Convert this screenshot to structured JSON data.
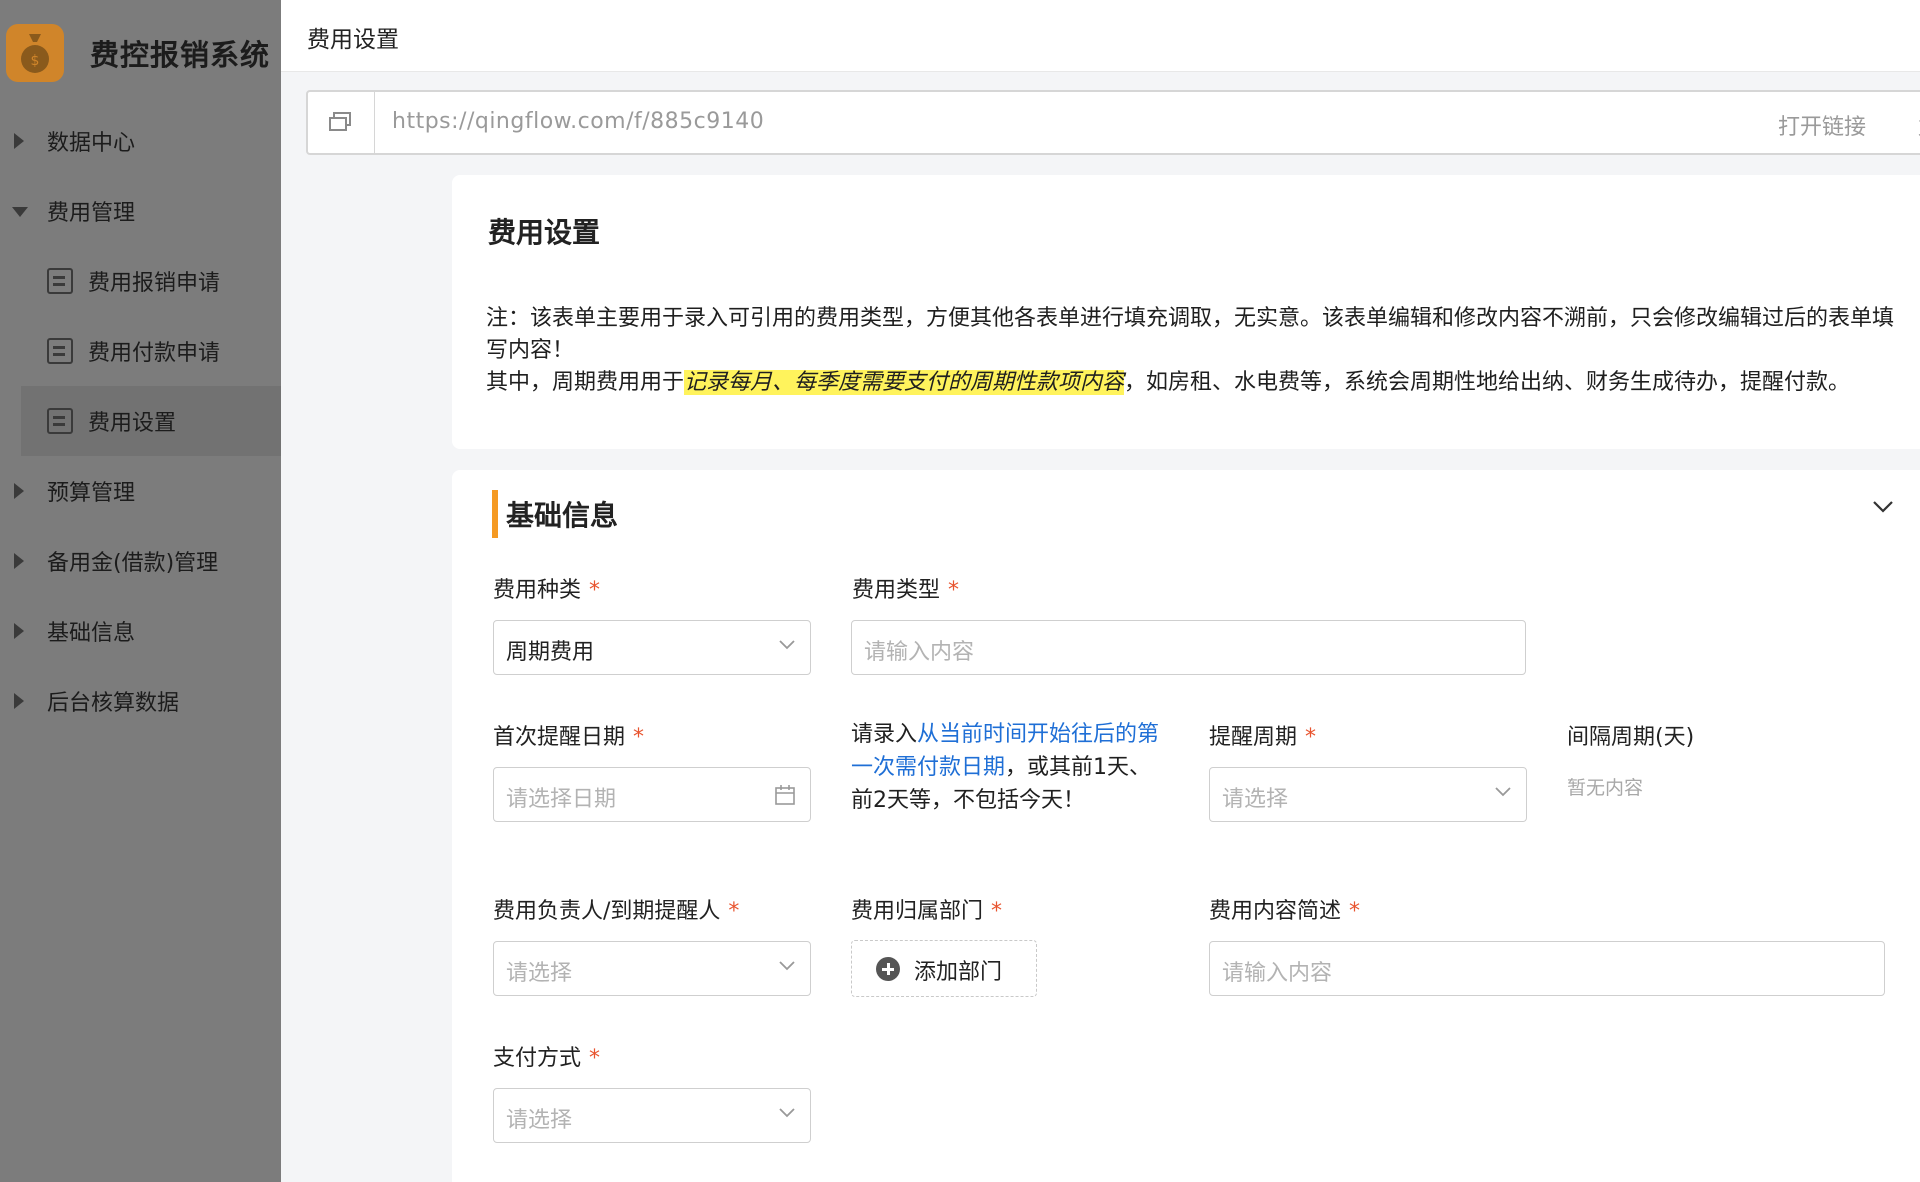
{
  "app": {
    "title": "费控报销系统"
  },
  "sidebar": {
    "items": [
      {
        "label": "数据中心",
        "expanded": false
      },
      {
        "label": "费用管理",
        "expanded": true
      },
      {
        "label": "费用报销申请",
        "sub": true
      },
      {
        "label": "费用付款申请",
        "sub": true
      },
      {
        "label": "费用设置",
        "sub": true,
        "active": true
      },
      {
        "label": "预算管理",
        "expanded": false
      },
      {
        "label": "备用金(借款)管理",
        "expanded": false
      },
      {
        "label": "基础信息",
        "expanded": false
      },
      {
        "label": "后台核算数据",
        "expanded": false
      }
    ]
  },
  "topbar": {
    "breadcrumb": "费用设置"
  },
  "urlbar": {
    "url": "https://qingflow.com/f/885c9140",
    "open_label": "打开链接",
    "more_label": "复"
  },
  "note_card": {
    "title": "费用设置",
    "line1": "注：该表单主要用于录入可引用的费用类型，方便其他各表单进行填充调取，无实意。该表单编辑和修改内容不溯前，只会修改编辑过后的表单填写内容！",
    "line2_prefix": "其中，周期费用用于",
    "line2_highlight": "记录每月、每季度需要支付的周期性款项内容",
    "line2_suffix": "，如房租、水电费等，系统会周期性地给出纳、财务生成待办，提醒付款。"
  },
  "form": {
    "section_title": "基础信息",
    "required_mark": "*",
    "fields": {
      "category": {
        "label": "费用种类",
        "value": "周期费用"
      },
      "type": {
        "label": "费用类型",
        "placeholder": "请输入内容"
      },
      "first_date": {
        "label": "首次提醒日期",
        "placeholder": "请选择日期"
      },
      "hint": {
        "prefix": "请录入",
        "blue": "从当前时间开始往后的第一次需付款日期",
        "suffix": "，或其前1天、前2天等，不包括今天！"
      },
      "cycle": {
        "label": "提醒周期",
        "placeholder": "请选择"
      },
      "interval": {
        "label": "间隔周期(天)",
        "empty": "暂无内容"
      },
      "owner": {
        "label": "费用负责人/到期提醒人",
        "placeholder": "请选择"
      },
      "dept": {
        "label": "费用归属部门",
        "button": "添加部门"
      },
      "desc": {
        "label": "费用内容简述",
        "placeholder": "请输入内容"
      },
      "payment": {
        "label": "支付方式",
        "placeholder": "请选择"
      }
    }
  },
  "colors": {
    "accent": "#f59a23",
    "required": "#e8542f",
    "link_blue": "#1f6fd6",
    "highlight": "#fff35c",
    "sidebar": "#7c7c7c"
  }
}
